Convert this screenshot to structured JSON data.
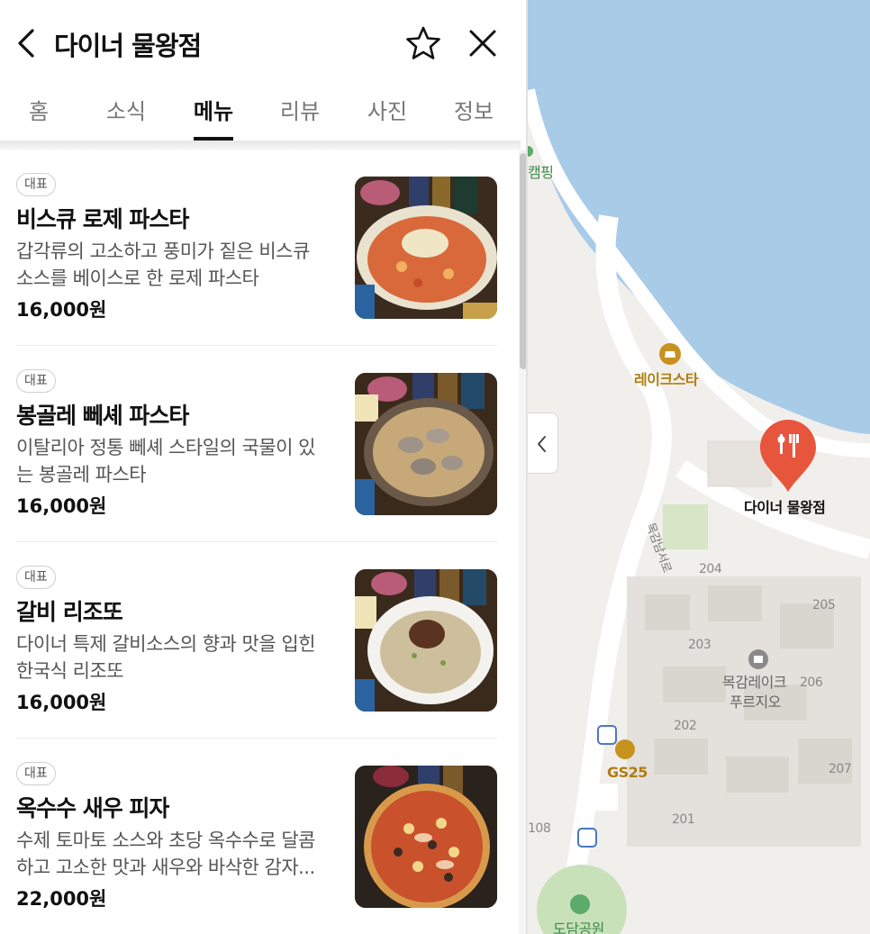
{
  "header": {
    "title": "다이너 물왕점"
  },
  "tabs": [
    {
      "label": "홈"
    },
    {
      "label": "소식"
    },
    {
      "label": "메뉴"
    },
    {
      "label": "리뷰"
    },
    {
      "label": "사진"
    },
    {
      "label": "정보"
    }
  ],
  "active_tab": "메뉴",
  "menu": [
    {
      "badge": "대표",
      "name": "비스큐 로제 파스타",
      "desc": "갑각류의 고소하고 풍미가 짙은 비스큐 소스를 베이스로 한 로제 파스타",
      "price": "16,000원"
    },
    {
      "badge": "대표",
      "name": "봉골레 뻬셰 파스타",
      "desc": "이탈리아 정통 뻬셰 스타일의 국물이 있는 봉골레 파스타",
      "price": "16,000원"
    },
    {
      "badge": "대표",
      "name": "갈비 리조또",
      "desc": "다이너 특제 갈비소스의 향과 맛을 입힌 한국식 리조또",
      "price": "16,000원"
    },
    {
      "badge": "대표",
      "name": "옥수수 새우 피자",
      "desc": "수제 토마토 소스와 초당 옥수수로 달콤하고 고소한 맛과 새우와 바삭한 감자...",
      "price": "22,000원"
    }
  ],
  "map": {
    "labels": {
      "camping": "캠핑",
      "lakestar": "레이크스타",
      "diner": "다이너 물왕점",
      "road": "목감남서로",
      "b204": "204",
      "b205": "205",
      "b203": "203",
      "b206": "206",
      "b202": "202",
      "b207": "207",
      "b201": "201",
      "b108": "108",
      "apt_line1": "목감레이크",
      "apt_line2": "푸르지오",
      "gs25": "GS25",
      "park": "도담공원"
    },
    "colors": {
      "water": "#a8cbe8",
      "marker": "#e8553d",
      "poi_gold": "#c8921f",
      "bus_blue": "#4a78c4",
      "park_green": "#5cab6a"
    }
  }
}
